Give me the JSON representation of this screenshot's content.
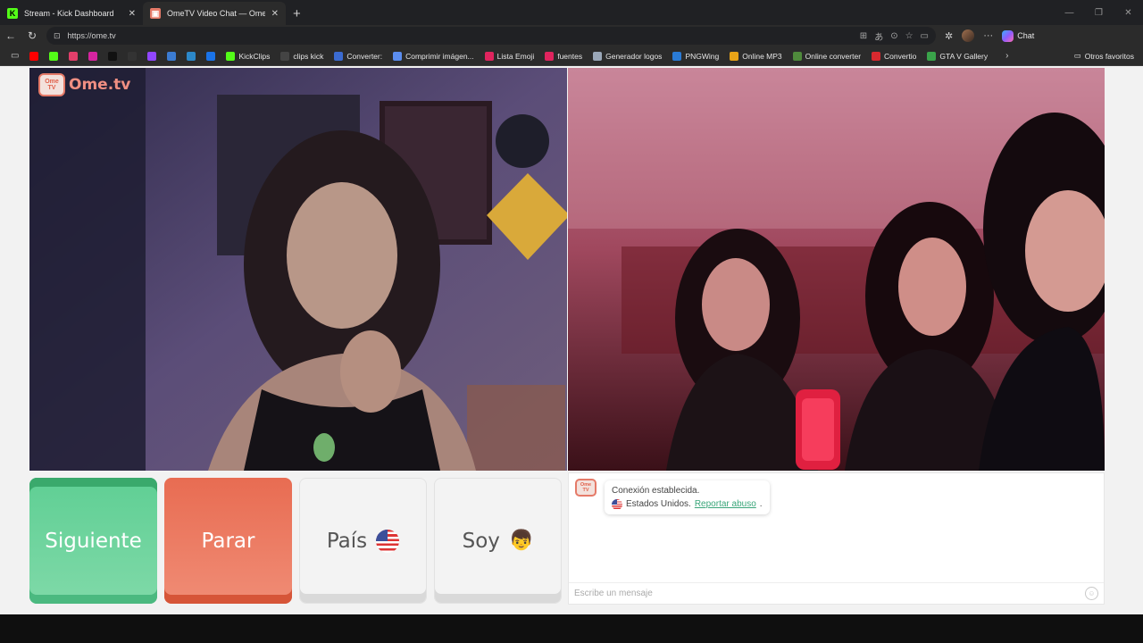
{
  "browser": {
    "tabs": [
      {
        "title": "Stream - Kick Dashboard",
        "icon": "kick-icon",
        "color": "#53fc18",
        "active": false
      },
      {
        "title": "OmeTV Video Chat — Omegle",
        "icon": "ometv-icon",
        "color": "#e57a68",
        "active": true
      }
    ],
    "url": "https://ome.tv",
    "copilot_label": "Chat",
    "bookmarks": [
      {
        "label": "",
        "icon": "youtube-icon",
        "color": "#ff0000"
      },
      {
        "label": "",
        "icon": "kick-icon",
        "color": "#53fc18"
      },
      {
        "label": "",
        "icon": "kick-alt-icon",
        "color": "#e23f6a"
      },
      {
        "label": "",
        "icon": "instagram-icon",
        "color": "#d6249f"
      },
      {
        "label": "",
        "icon": "tiktok-icon",
        "color": "#111111"
      },
      {
        "label": "",
        "icon": "streamlabs-icon",
        "color": "#333333"
      },
      {
        "label": "",
        "icon": "twitch-icon",
        "color": "#9146ff"
      },
      {
        "label": "",
        "icon": "tool-icon",
        "color": "#3b7bd1"
      },
      {
        "label": "",
        "icon": "tool2-icon",
        "color": "#2c88c9"
      },
      {
        "label": "",
        "icon": "edge-icon",
        "color": "#1a73e8"
      },
      {
        "label": "KickClips",
        "icon": "kick-icon",
        "color": "#53fc18"
      },
      {
        "label": "clips kick",
        "icon": "clips-icon",
        "color": "#444444"
      },
      {
        "label": "Converter:",
        "icon": "converter-icon",
        "color": "#3b6bd1"
      },
      {
        "label": "Comprimir imágen...",
        "icon": "heart-icon",
        "color": "#5b8def"
      },
      {
        "label": "Lista Emoji",
        "icon": "bolt-icon",
        "color": "#e0245e"
      },
      {
        "label": "fuentes",
        "icon": "bolt-icon",
        "color": "#e0245e"
      },
      {
        "label": "Generador logos",
        "icon": "gem-icon",
        "color": "#9aa7b8"
      },
      {
        "label": "PNGWing",
        "icon": "wing-icon",
        "color": "#2a7bd6"
      },
      {
        "label": "Online MP3",
        "icon": "dots-icon",
        "color": "#e8a317"
      },
      {
        "label": "Online converter",
        "icon": "oc-icon",
        "color": "#4f8a3c"
      },
      {
        "label": "Convertio",
        "icon": "convertio-icon",
        "color": "#d8292f"
      },
      {
        "label": "GTA V Gallery",
        "icon": "gta-icon",
        "color": "#3aa34a"
      }
    ],
    "other_favorites": "Otros favoritos"
  },
  "site": {
    "logo_badge": "Ome TV",
    "logo_text": "Ome.tv"
  },
  "controls": {
    "next": "Siguiente",
    "stop": "Parar",
    "country": "País",
    "me": "Soy"
  },
  "chat": {
    "avatar": "Ome TV",
    "connected": "Conexión establecida.",
    "country": "Estados Unidos.",
    "report": "Reportar abuso",
    "report_suffix": ".",
    "placeholder": "Escribe un mensaje"
  }
}
